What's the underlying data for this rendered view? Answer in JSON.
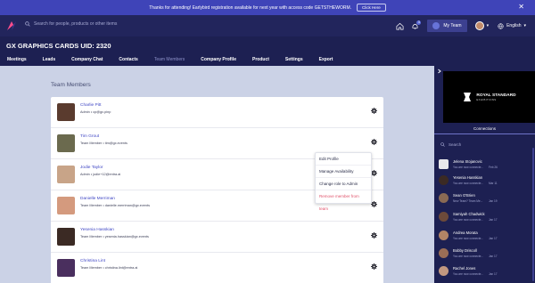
{
  "banner": {
    "text": "Thanks for attending! Earlybird registration available for next year with access code GETSTHEWORM.",
    "button": "Click Here",
    "close": "✕"
  },
  "topbar": {
    "search_placeholder": "Search for people, products or other items",
    "notification_count": "3",
    "my_team": "My Team",
    "language": "English",
    "caret": "▾"
  },
  "company": {
    "title": "GX GRAPHICS CARDS UID: 2320"
  },
  "nav": {
    "items": [
      "Meetings",
      "Leads",
      "Company Chat",
      "Contacts",
      "Team Members",
      "Company Profile",
      "Product",
      "Settings",
      "Export"
    ],
    "active": "Team Members"
  },
  "team": {
    "title": "Team Members",
    "members": [
      {
        "name": "Charlie Pitt",
        "meta": "Admin  •  cp@gx.pinp",
        "avatar_color": "#5a3b2e"
      },
      {
        "name": "Tim Grout",
        "meta": "Team Member  •  tim@gx.events",
        "avatar_color": "#6b6a4e"
      },
      {
        "name": "Jodie Taylor",
        "meta": "Admin  •  jodie+12@entra.ai",
        "avatar_color": "#c8a488"
      },
      {
        "name": "Danielle Merriman",
        "meta": "Team Member  •  danielle.merriman@gx.events",
        "avatar_color": "#d49a7e"
      },
      {
        "name": "Yesenia Hasskian",
        "meta": "Team Member  •  yesenia.hasskian@gx.events",
        "avatar_color": "#3b2a24"
      },
      {
        "name": "Christina Lint",
        "meta": "Team Member  •  christina.lint@entra.ai",
        "avatar_color": "#4a2f5e"
      }
    ]
  },
  "context_menu": {
    "items": [
      "Edit Profile",
      "Manage Availability",
      "Change role to Admin",
      "Remove member from team"
    ]
  },
  "sidebar": {
    "brand_title": "ROYAL STANDARD",
    "brand_sub": "EXHIBITIONS",
    "connections_tab": "Connections",
    "search_placeholder": "Search",
    "contacts": [
      {
        "name": "Jelena Stojanovic",
        "msg": "You are now connecte...",
        "date": "Feb 26",
        "color": "#e8e8ea"
      },
      {
        "name": "Yesenia Hasskian",
        "msg": "You are now connecte...",
        "date": "Mar 11",
        "color": "#3b2a24"
      },
      {
        "name": "Sean O'Brien",
        "msg": "New Team? Team Me...",
        "date": "Jan 19",
        "color": "#8a6a54"
      },
      {
        "name": "Samiyah Chadwick",
        "msg": "You are now connecte...",
        "date": "Jan 17",
        "color": "#6d4a3a"
      },
      {
        "name": "Andrea Morata",
        "msg": "You are now connecte...",
        "date": "Jan 17",
        "color": "#b28466"
      },
      {
        "name": "Bobby Driscoll",
        "msg": "You are now connecte...",
        "date": "Jan 17",
        "color": "#9b6e56"
      },
      {
        "name": "Rachel Jones",
        "msg": "You are now connecte...",
        "date": "Jan 17",
        "color": "#c29880"
      }
    ]
  },
  "colors": {
    "accent": "#3f44b8",
    "navy": "#1d2052",
    "danger": "#e0526a",
    "link": "#3f46c4"
  }
}
